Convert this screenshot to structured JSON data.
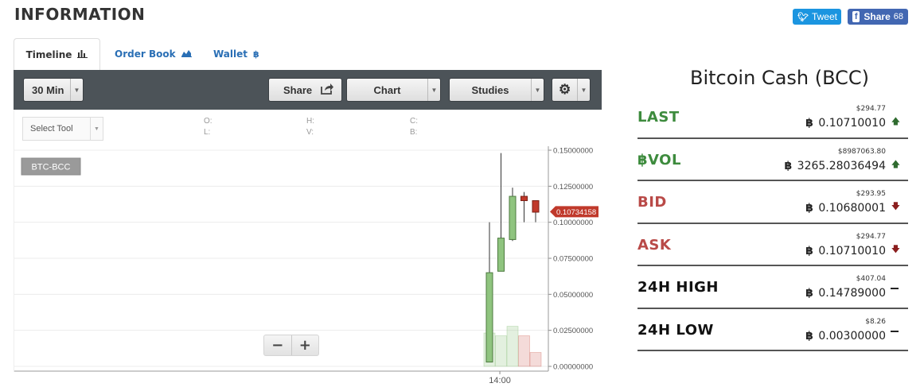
{
  "page": {
    "title": "INFORMATION"
  },
  "social": {
    "tweet_label": "Tweet",
    "share_label": "Share",
    "share_count": "68"
  },
  "tabs": [
    {
      "label": "Timeline",
      "icon": "bar-chart-icon",
      "active": true
    },
    {
      "label": "Order Book",
      "icon": "area-chart-icon",
      "active": false
    },
    {
      "label": "Wallet",
      "icon": "bitcoin-icon",
      "active": false
    }
  ],
  "toolbar": {
    "interval": "30 Min",
    "share_label": "Share",
    "chart_label": "Chart",
    "studies_label": "Studies",
    "select_tool_placeholder": "Select Tool"
  },
  "ohlc_labels": {
    "open": "O:",
    "high": "H:",
    "close": "C:",
    "low": "L:",
    "volume": "V:",
    "b": "B:"
  },
  "colors": {
    "up": "#8fc47f",
    "down": "#c0392b",
    "price_tag": "#c0392b",
    "stat_green": "#3d8b3d",
    "stat_red": "#b94a48"
  },
  "chart_data": {
    "type": "candlestick",
    "symbol": "BTC-BCC",
    "last_price_label": "0.10734158",
    "y_ticks": [
      "0.15000000",
      "0.12500000",
      "0.10000000",
      "0.07500000",
      "0.05000000",
      "0.02500000",
      "0.00000000"
    ],
    "ylim": [
      0,
      0.15
    ],
    "x_ticks": [
      "14:00"
    ],
    "candles": [
      {
        "open": 0.003,
        "high": 0.1,
        "low": 0.003,
        "close": 0.065
      },
      {
        "open": 0.066,
        "high": 0.148,
        "low": 0.066,
        "close": 0.089
      },
      {
        "open": 0.088,
        "high": 0.124,
        "low": 0.087,
        "close": 0.118
      },
      {
        "open": 0.118,
        "high": 0.121,
        "low": 0.1,
        "close": 0.115
      },
      {
        "open": 0.115,
        "high": 0.115,
        "low": 0.1,
        "close": 0.107
      }
    ],
    "volume_bars": [
      {
        "value": 0.6,
        "dir": "up"
      },
      {
        "value": 0.55,
        "dir": "up"
      },
      {
        "value": 0.72,
        "dir": "up"
      },
      {
        "value": 0.55,
        "dir": "down"
      },
      {
        "value": 0.25,
        "dir": "down"
      }
    ]
  },
  "market": {
    "title": "Bitcoin Cash (BCC)",
    "stats": [
      {
        "label": "LAST",
        "usd": "$294.77",
        "value": "0.10710010",
        "trend": "up"
      },
      {
        "label": "฿VOL",
        "usd": "$8987063.80",
        "value": "3265.28036494",
        "trend": "up"
      },
      {
        "label": "BID",
        "usd": "$293.95",
        "value": "0.10680001",
        "trend": "down"
      },
      {
        "label": "ASK",
        "usd": "$294.77",
        "value": "0.10710010",
        "trend": "down"
      },
      {
        "label": "24H HIGH",
        "usd": "$407.04",
        "value": "0.14789000",
        "trend": "flat"
      },
      {
        "label": "24H LOW",
        "usd": "$8.26",
        "value": "0.00300000",
        "trend": "flat"
      }
    ]
  }
}
